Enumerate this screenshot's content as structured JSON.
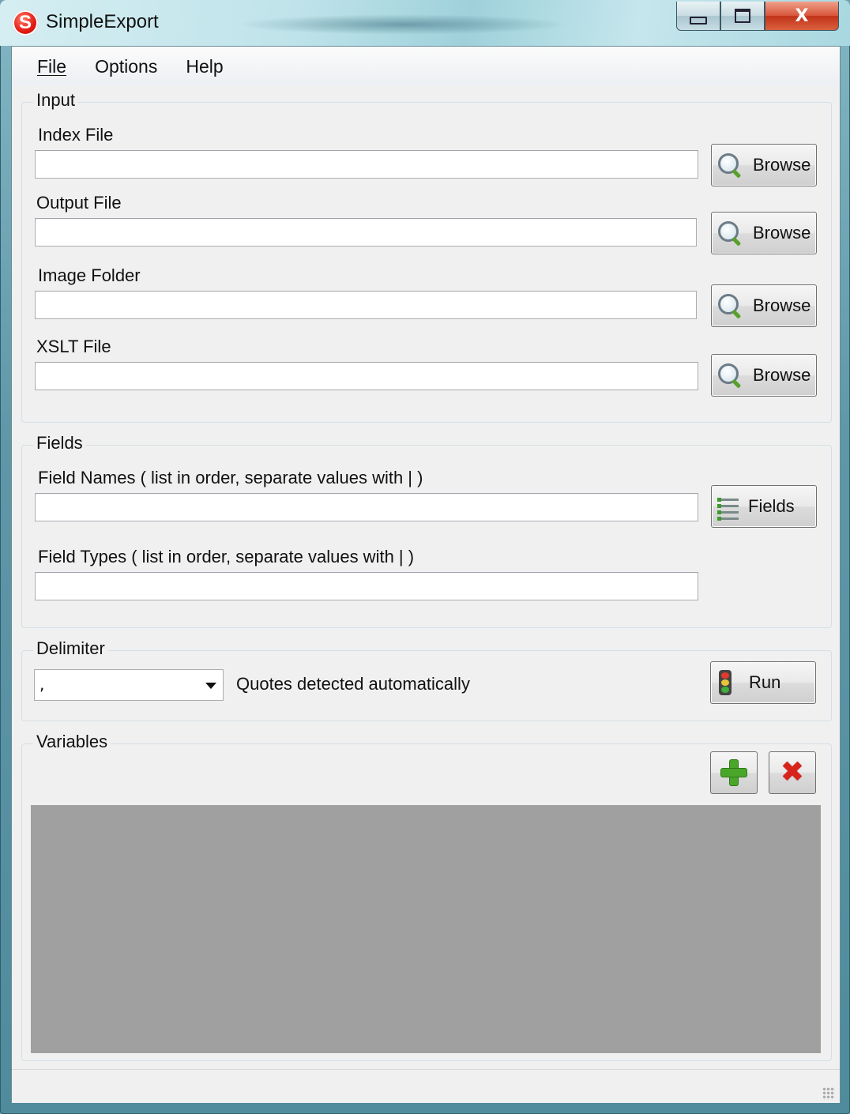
{
  "window": {
    "title": "SimpleExport",
    "minimize_icon": "minimize-icon",
    "maximize_icon": "maximize-icon",
    "close_icon": "close-icon",
    "close_glyph": "X"
  },
  "menu": {
    "file": "File",
    "options": "Options",
    "help": "Help"
  },
  "input_group": {
    "legend": "Input",
    "index_file": {
      "label": "Index File",
      "value": "",
      "button": "Browse"
    },
    "output_file": {
      "label": "Output File",
      "value": "",
      "button": "Browse"
    },
    "image_folder": {
      "label": "Image Folder",
      "value": "",
      "button": "Browse"
    },
    "xslt_file": {
      "label": "XSLT File",
      "value": "",
      "button": "Browse"
    }
  },
  "fields_group": {
    "legend": "Fields",
    "field_names": {
      "label": "Field Names ( list in order, separate values with | )",
      "value": ""
    },
    "fields_button": "Fields",
    "field_types": {
      "label": "Field Types ( list in order, separate values with | )",
      "value": ""
    }
  },
  "delimiter_group": {
    "legend": "Delimiter",
    "selected": ",",
    "note": "Quotes detected automatically",
    "run_button": "Run"
  },
  "variables_group": {
    "legend": "Variables",
    "add_icon": "plus-icon",
    "remove_icon": "x-icon",
    "remove_glyph": "✖"
  },
  "colors": {
    "accent_green": "#4aa62a",
    "delete_red": "#d8231a",
    "grid_gray": "#a0a0a0"
  }
}
